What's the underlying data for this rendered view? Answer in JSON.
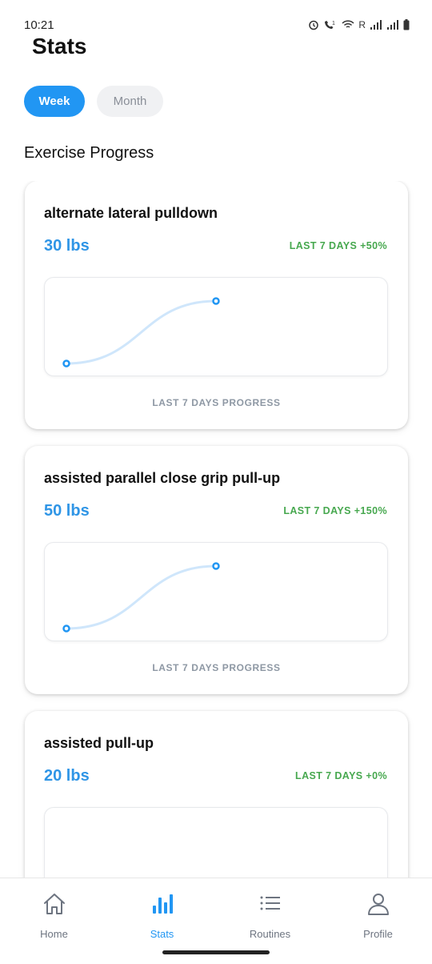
{
  "status_bar": {
    "time": "10:21",
    "carrier_letter": "R"
  },
  "header": {
    "title": "Stats"
  },
  "period_tabs": [
    {
      "label": "Week",
      "active": true
    },
    {
      "label": "Month",
      "active": false
    }
  ],
  "section": {
    "title": "Exercise Progress"
  },
  "exercises": [
    {
      "name": "alternate lateral pulldown",
      "weight": "30 lbs",
      "change": "LAST 7 DAYS +50%",
      "caption": "LAST 7 DAYS PROGRESS",
      "chart_values": [
        20,
        30
      ]
    },
    {
      "name": "assisted parallel close grip pull-up",
      "weight": "50 lbs",
      "change": "LAST 7 DAYS +150%",
      "caption": "LAST 7 DAYS PROGRESS",
      "chart_values": [
        20,
        50
      ]
    },
    {
      "name": "assisted pull-up",
      "weight": "20 lbs",
      "change": "LAST 7 DAYS +0%",
      "caption": "",
      "chart_values": []
    }
  ],
  "bottom_nav": [
    {
      "label": "Home",
      "icon": "home-icon",
      "active": false
    },
    {
      "label": "Stats",
      "icon": "bar-chart-icon",
      "active": true
    },
    {
      "label": "Routines",
      "icon": "list-icon",
      "active": false
    },
    {
      "label": "Profile",
      "icon": "person-icon",
      "active": false
    }
  ],
  "colors": {
    "accent": "#2196f3",
    "weight_text": "#2f95e6",
    "positive_change": "#47a84f",
    "chart_line": "#cfe6fb",
    "inactive_tab_bg": "#f0f1f3"
  }
}
